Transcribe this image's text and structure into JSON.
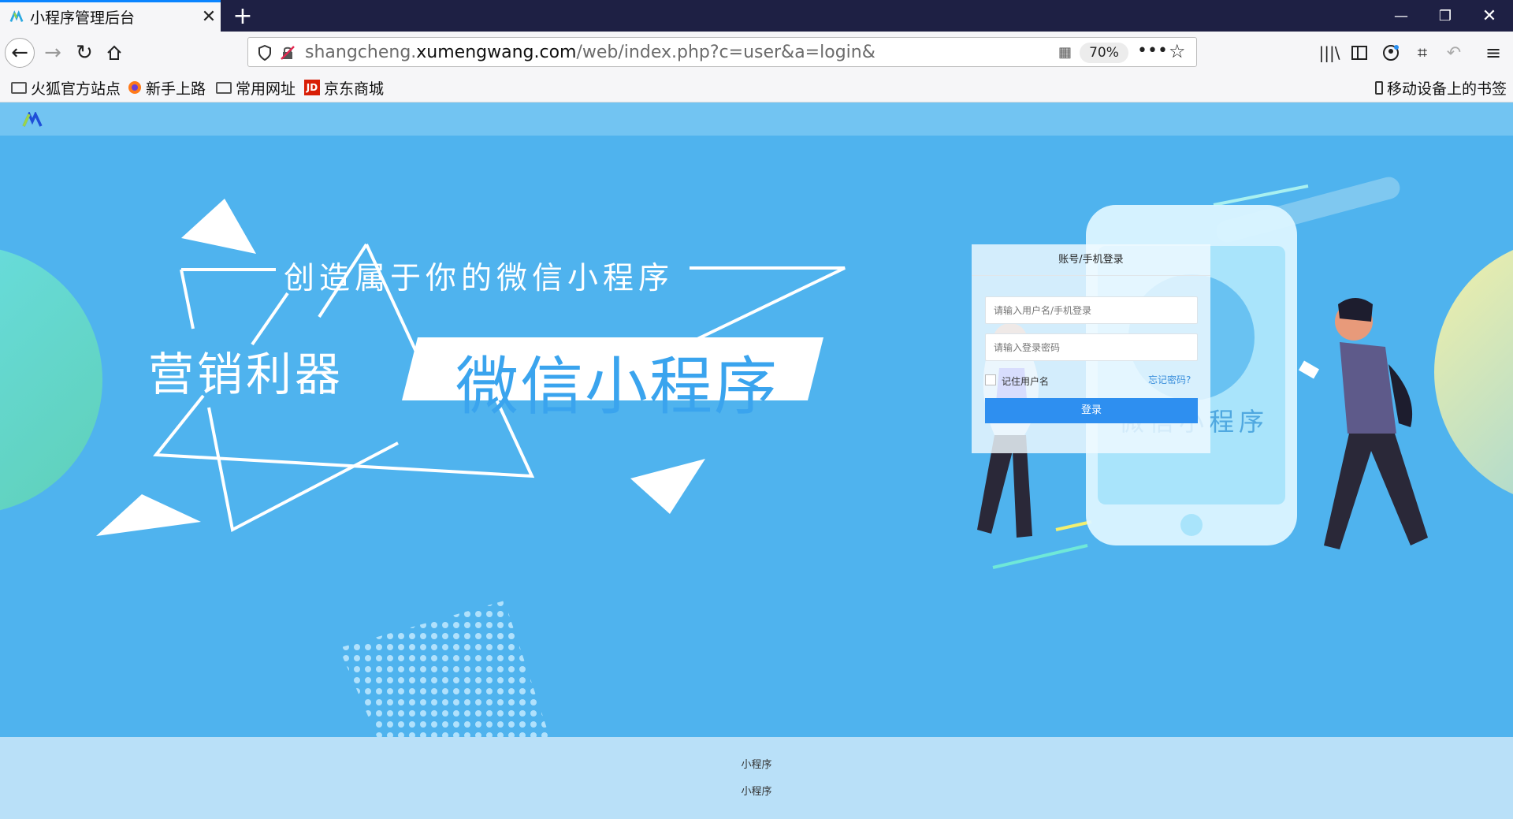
{
  "browser": {
    "tab_title": "小程序管理后台",
    "url_host_prefix": "shangcheng.",
    "url_host_domain": "xumengwang.com",
    "url_path": "/web/index.php?c=user&a=login&",
    "zoom": "70%",
    "bookmarks": [
      "火狐官方站点",
      "新手上路",
      "常用网址",
      "京东商城"
    ],
    "mobile_bookmarks": "移动设备上的书签"
  },
  "hero": {
    "tagline": "创造属于你的微信小程序",
    "left_title": "营销利器",
    "main_title": "微信小程序",
    "phone_text": "微信小程序"
  },
  "login": {
    "header": "账号/手机登录",
    "username_placeholder": "请输入用户名/手机登录",
    "password_placeholder": "请输入登录密码",
    "remember": "记住用户名",
    "forgot": "忘记密码?",
    "submit": "登录"
  },
  "footer": {
    "line1": "小程序",
    "line2": "小程序"
  },
  "colors": {
    "hero_bg": "#4fb3ee",
    "button": "#2e8ff0",
    "header_bar": "#72c4f2",
    "footer_bg": "#b9e0f8"
  }
}
